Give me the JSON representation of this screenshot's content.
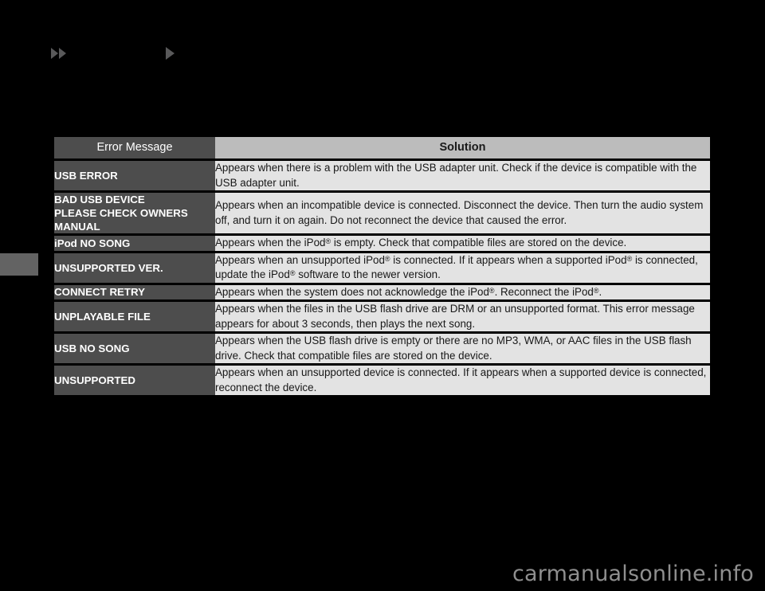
{
  "page": {
    "background_color": "#000000",
    "watermark": "carmanualsonline.info",
    "edge_tab_color": "#636363"
  },
  "nav": {
    "prev_icon": "double-triangle-right-icon",
    "next_icon": "triangle-right-icon"
  },
  "table": {
    "headers": {
      "error_message": "Error Message",
      "solution": "Solution"
    },
    "colors": {
      "label_bg": "#4d4d4d",
      "header_solution_bg": "#bcbcbc",
      "solution_bg": "#e3e3e3",
      "text_light": "#ffffff",
      "text_dark": "#181818"
    },
    "rows": [
      {
        "error_message": "USB ERROR",
        "solution": "Appears when there is a problem with the USB adapter unit. Check if the device is compatible with the USB adapter unit."
      },
      {
        "error_message": "BAD USB DEVICE\nPLEASE CHECK OWNERS\nMANUAL",
        "solution": "Appears when an incompatible device is connected. Disconnect the device. Then turn the audio system off, and turn it on again. Do not reconnect the device that caused the error."
      },
      {
        "error_message": "iPod NO SONG",
        "solution": "Appears when the iPod® is empty. Check that compatible files are stored on the device."
      },
      {
        "error_message": "UNSUPPORTED VER.",
        "solution": "Appears when an unsupported iPod® is connected. If it appears when a supported iPod® is connected, update the iPod® software to the newer version."
      },
      {
        "error_message": "CONNECT RETRY",
        "solution": "Appears when the system does not acknowledge the iPod®. Reconnect the iPod®."
      },
      {
        "error_message": "UNPLAYABLE FILE",
        "solution": "Appears when the files in the USB flash drive are DRM or an unsupported format. This error message appears for about 3 seconds, then plays the next song."
      },
      {
        "error_message": "USB NO SONG",
        "solution": "Appears when the USB flash drive is empty or there are no MP3, WMA, or AAC files in the USB flash drive. Check that compatible files are stored on the device."
      },
      {
        "error_message": "UNSUPPORTED",
        "solution": "Appears when an unsupported device is connected. If it appears when a supported device is connected, reconnect the device."
      }
    ]
  }
}
